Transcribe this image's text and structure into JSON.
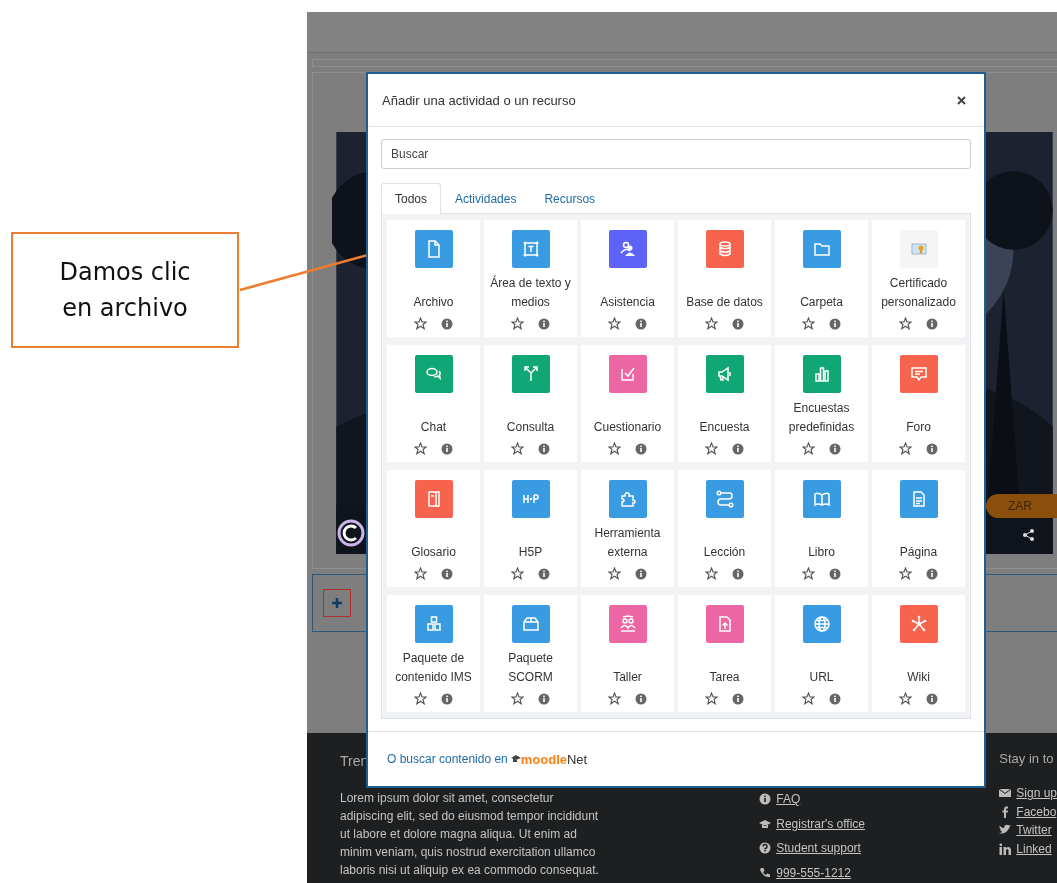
{
  "callout": {
    "text": "Damos clic en archivo"
  },
  "background": {
    "button_label": "ZAR",
    "footer": {
      "heading": "Tren",
      "text": "Lorem ipsum dolor sit amet, consectetur adipiscing elit, sed do eiusmod tempor incididunt ut labore et dolore magna aliqua. Ut enim ad minim veniam, quis nostrud exercitation ullamco laboris nisi ut aliquip ex ea commodo consequat.",
      "links": [
        {
          "kind": "info",
          "label": "FAQ"
        },
        {
          "kind": "cap",
          "label": "Registrar's office"
        },
        {
          "kind": "question",
          "label": "Student support"
        },
        {
          "kind": "phone",
          "label": "999-555-1212"
        }
      ],
      "social_heading": "Stay in to",
      "social": [
        {
          "kind": "mail",
          "label": "Sign up"
        },
        {
          "kind": "facebook",
          "label": "Facebo"
        },
        {
          "kind": "twitter",
          "label": "Twitter"
        },
        {
          "kind": "linkedin",
          "label": "Linked"
        }
      ]
    }
  },
  "modal": {
    "title": "Añadir una actividad o un recurso",
    "search": {
      "placeholder": "Buscar"
    },
    "tabs": [
      {
        "label": "Todos",
        "selected": true
      },
      {
        "label": "Actividades",
        "selected": false
      },
      {
        "label": "Recursos",
        "selected": false
      }
    ],
    "items": [
      {
        "name": "Archivo",
        "kind": "file",
        "color": "#399be2"
      },
      {
        "name": "Área de texto y medios",
        "kind": "textarea",
        "color": "#399be2"
      },
      {
        "name": "Asistencia",
        "kind": "people",
        "color": "#5d63f6"
      },
      {
        "name": "Base de datos",
        "kind": "database",
        "color": "#f7634d"
      },
      {
        "name": "Carpeta",
        "kind": "folder",
        "color": "#399be2"
      },
      {
        "name": "Certificado personalizado",
        "kind": "certificate",
        "color": "#f5f5f5"
      },
      {
        "name": "Chat",
        "kind": "chat",
        "color": "#11a676"
      },
      {
        "name": "Consulta",
        "kind": "fork",
        "color": "#11a676"
      },
      {
        "name": "Cuestionario",
        "kind": "check",
        "color": "#eb66a2"
      },
      {
        "name": "Encuesta",
        "kind": "megaphone",
        "color": "#11a676"
      },
      {
        "name": "Encuestas predefinidas",
        "kind": "chart",
        "color": "#11a676"
      },
      {
        "name": "Foro",
        "kind": "forum",
        "color": "#f7634d"
      },
      {
        "name": "Glosario",
        "kind": "notebook",
        "color": "#f7634d"
      },
      {
        "name": "H5P",
        "kind": "h5p",
        "color": "#399be2"
      },
      {
        "name": "Herramienta externa",
        "kind": "puzzle",
        "color": "#399be2"
      },
      {
        "name": "Lección",
        "kind": "path",
        "color": "#399be2"
      },
      {
        "name": "Libro",
        "kind": "book",
        "color": "#399be2"
      },
      {
        "name": "Página",
        "kind": "page",
        "color": "#399be2"
      },
      {
        "name": "Paquete de contenido IMS",
        "kind": "blocks",
        "color": "#399be2"
      },
      {
        "name": "Paquete SCORM",
        "kind": "box",
        "color": "#399be2"
      },
      {
        "name": "Taller",
        "kind": "group",
        "color": "#eb66a2"
      },
      {
        "name": "Tarea",
        "kind": "upload",
        "color": "#eb66a2"
      },
      {
        "name": "URL",
        "kind": "globe",
        "color": "#399be2"
      },
      {
        "name": "Wiki",
        "kind": "network",
        "color": "#f7634d"
      }
    ],
    "footer": {
      "link": "O buscar contenido en",
      "logo_a": "moodle",
      "logo_b": "Net"
    }
  }
}
